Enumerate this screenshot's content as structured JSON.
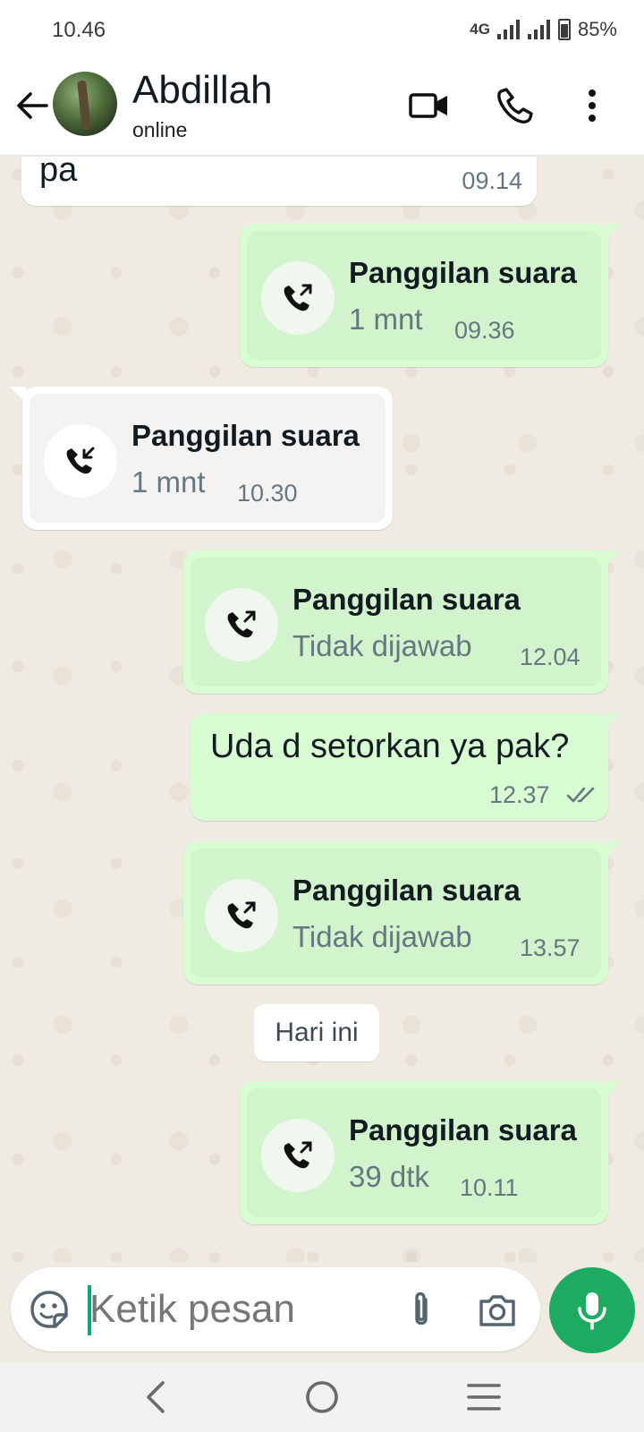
{
  "status_bar": {
    "time": "10.46",
    "network": "4G",
    "battery": "85%"
  },
  "header": {
    "contact_name": "Abdillah",
    "contact_status": "online",
    "icons": [
      "back-arrow-icon",
      "video-call-icon",
      "voice-call-icon",
      "more-options-icon"
    ]
  },
  "messages": [
    {
      "type": "text",
      "direction": "incoming",
      "text": "pa",
      "time": "09.14"
    },
    {
      "type": "call",
      "direction": "outgoing",
      "title": "Panggilan suara",
      "detail": "1 mnt",
      "time": "09.36"
    },
    {
      "type": "call",
      "direction": "incoming",
      "title": "Panggilan suara",
      "detail": "1 mnt",
      "time": "10.30"
    },
    {
      "type": "call",
      "direction": "outgoing",
      "title": "Panggilan suara",
      "detail": "Tidak dijawab",
      "time": "12.04"
    },
    {
      "type": "text",
      "direction": "outgoing",
      "text": "Uda d setorkan ya pak?",
      "time": "12.37",
      "status": "read"
    },
    {
      "type": "call",
      "direction": "outgoing",
      "title": "Panggilan suara",
      "detail": "Tidak dijawab",
      "time": "13.57"
    },
    {
      "type": "date",
      "text": "Hari ini"
    },
    {
      "type": "call",
      "direction": "outgoing",
      "title": "Panggilan suara",
      "detail": "39 dtk",
      "time": "10.11"
    }
  ],
  "composer": {
    "placeholder": "Ketik pesan"
  },
  "colors": {
    "outgoing_bubble": "#d9fdd3",
    "incoming_bubble": "#ffffff",
    "accent": "#1daa61",
    "chat_background": "#efeae2",
    "read_ticks": "#667781"
  }
}
